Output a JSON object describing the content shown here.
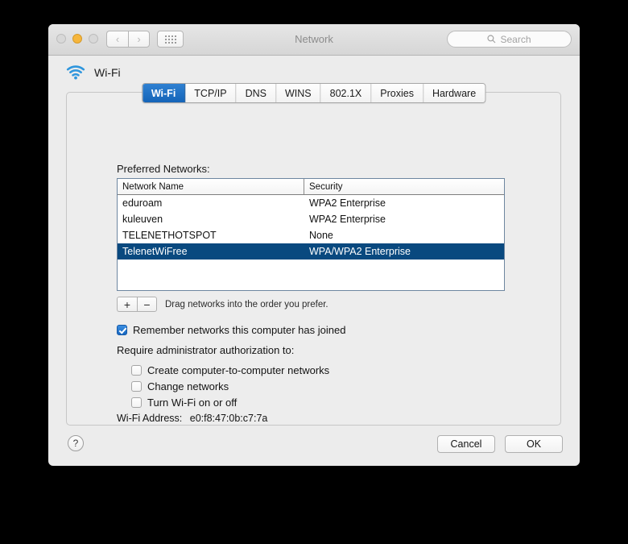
{
  "window": {
    "title": "Network",
    "traffic_lights": [
      {
        "name": "close",
        "state": "inactive"
      },
      {
        "name": "minimize",
        "state": "active"
      },
      {
        "name": "zoom",
        "state": "inactive"
      }
    ],
    "nav_back": "‹",
    "nav_forward": "›",
    "show_all_icon": "grid-icon"
  },
  "search": {
    "placeholder": "Search",
    "icon": "search-icon",
    "value": ""
  },
  "service": {
    "name": "Wi-Fi",
    "icon": "wifi-icon"
  },
  "tabs": [
    {
      "label": "Wi-Fi",
      "active": true
    },
    {
      "label": "TCP/IP",
      "active": false
    },
    {
      "label": "DNS",
      "active": false
    },
    {
      "label": "WINS",
      "active": false
    },
    {
      "label": "802.1X",
      "active": false
    },
    {
      "label": "Proxies",
      "active": false
    },
    {
      "label": "Hardware",
      "active": false
    }
  ],
  "preferred_networks": {
    "label": "Preferred Networks:",
    "columns": [
      "Network Name",
      "Security"
    ],
    "rows": [
      {
        "name": "eduroam",
        "security": "WPA2 Enterprise",
        "selected": false
      },
      {
        "name": "kuleuven",
        "security": "WPA2 Enterprise",
        "selected": false
      },
      {
        "name": "TELENETHOTSPOT",
        "security": "None",
        "selected": false
      },
      {
        "name": "TelenetWiFree",
        "security": "WPA/WPA2 Enterprise",
        "selected": true
      }
    ],
    "add_button": "+",
    "remove_button": "−",
    "hint": "Drag networks into the order you prefer."
  },
  "options": {
    "remember": {
      "label": "Remember networks this computer has joined",
      "checked": true
    },
    "admin_section_label": "Require administrator authorization to:",
    "admin_items": [
      {
        "label": "Create computer-to-computer networks",
        "checked": false
      },
      {
        "label": "Change networks",
        "checked": false
      },
      {
        "label": "Turn Wi-Fi on or off",
        "checked": false
      }
    ]
  },
  "wifi_address": {
    "label": "Wi-Fi Address:",
    "value": "e0:f8:47:0b:c7:7a"
  },
  "footer": {
    "help": "?",
    "cancel": "Cancel",
    "ok": "OK"
  },
  "colors": {
    "selection_blue": "#09497f",
    "tab_blue": "#1464b8",
    "wifi_icon_blue": "#1e8ad6",
    "minimize_yellow": "#f6b63c"
  }
}
